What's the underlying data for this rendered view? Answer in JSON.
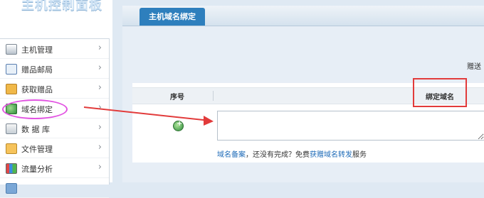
{
  "app": {
    "logo_text": "主机控制面板"
  },
  "sidebar": {
    "items": [
      {
        "label": "主机管理",
        "icon": "server-icon"
      },
      {
        "label": "赠品邮局",
        "icon": "mail-icon"
      },
      {
        "label": "获取赠品",
        "icon": "gift-icon"
      },
      {
        "label": "域名绑定",
        "icon": "domain-icon"
      },
      {
        "label": "数 据 库",
        "icon": "database-icon"
      },
      {
        "label": "文件管理",
        "icon": "file-icon"
      },
      {
        "label": "流量分析",
        "icon": "chart-icon"
      },
      {
        "label": "",
        "icon": "partial-icon"
      }
    ]
  },
  "main": {
    "tab_label": "主机域名绑定",
    "corner_text": "赠送",
    "table": {
      "col_index": "序号",
      "col_domain": "绑定域名"
    },
    "hint": {
      "link1": "域名备案",
      "text1": "，还没有完成？免费",
      "link2": "获赠域名转发",
      "text2": "服务"
    }
  },
  "annotations": {
    "circle_color": "#e254e2",
    "box_color": "#e23b3b",
    "arrow_color": "#e23b3b"
  }
}
